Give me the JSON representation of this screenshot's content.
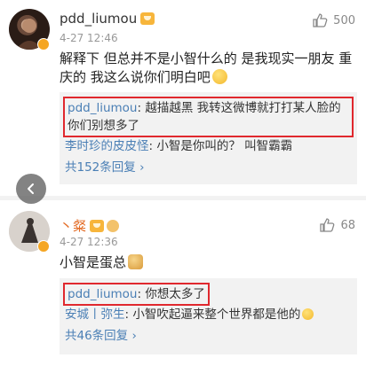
{
  "comments": [
    {
      "username": "pdd_liumou",
      "time": "4-27 12:46",
      "likes": "500",
      "text": "解释下 但总并不是小智什么的 是我现实一朋友 重庆的 我这么说你们明白吧",
      "emoji": "thinking-face",
      "replies": [
        {
          "name": "pdd_liumou",
          "sep": ": ",
          "text": "越描越黑 我转这微博就打打某人脸的你们别想多了",
          "highlighted": true
        },
        {
          "name": "李时珍的皮皮怪",
          "sep": ": ",
          "text": "小智是你叫的？ 叫智霸霸",
          "highlighted": false
        }
      ],
      "more_label": "共152条回复",
      "more_arrow": "›"
    },
    {
      "username": "丶粲",
      "time": "4-27 12:36",
      "likes": "68",
      "text": "小智是蛋总",
      "emoji": "doge",
      "replies": [
        {
          "name": "pdd_liumou",
          "sep": ": ",
          "text": "你想太多了",
          "highlighted": true
        },
        {
          "name": "安城丨弥生",
          "sep": ": ",
          "text": "小智吹起逼来整个世界都是他的",
          "highlighted": false
        }
      ],
      "more_label": "共46条回复",
      "more_arrow": "›"
    }
  ],
  "colors": {
    "reply_name": "#4a7fb5",
    "highlight_border": "#e0282e",
    "username_orange": "#e36b24"
  },
  "icons": {
    "like": "thumbs-up-icon",
    "back": "chevron-left-icon",
    "verified": "verified-badge-icon"
  }
}
